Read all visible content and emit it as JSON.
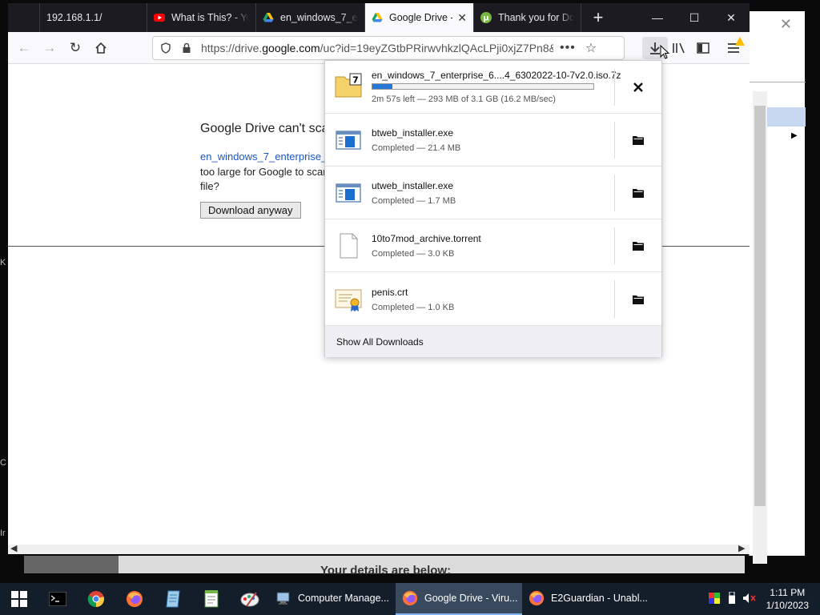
{
  "tabs": [
    {
      "label": "192.168.1.1/",
      "icon": "none"
    },
    {
      "label": "What is This? - Yo",
      "icon": "youtube-icon"
    },
    {
      "label": "en_windows_7_en",
      "icon": "google-drive-icon"
    },
    {
      "label": "Google Drive -",
      "icon": "google-drive-icon"
    },
    {
      "label": "Thank you for Do",
      "icon": "utorrent-icon"
    }
  ],
  "url": {
    "prefix": "https://drive.",
    "domain": "google.com",
    "suffix": "/uc?id=19eyZGtbPRirwvhkzlQAcLPji0xjZ7Pn8&"
  },
  "page": {
    "title": "Google Drive can't sca",
    "file_link": "en_windows_7_enterprise_",
    "text_line1": "too large for Google to scar",
    "text_line2": "file?",
    "download_button": "Download anyway"
  },
  "downloads": {
    "items": [
      {
        "name": "en_windows_7_enterprise_6....4_6302022-10-7v2.0.iso.7z",
        "status": "2m 57s left — 293 MB of 3.1 GB (16.2 MB/sec)",
        "progress": 0.092,
        "icon": "7z-archive-icon",
        "action_icon": "cancel-icon"
      },
      {
        "name": "btweb_installer.exe",
        "status": "Completed — 21.4 MB",
        "icon": "installer-icon",
        "action_icon": "folder-icon"
      },
      {
        "name": "utweb_installer.exe",
        "status": "Completed — 1.7 MB",
        "icon": "installer-icon",
        "action_icon": "folder-icon"
      },
      {
        "name": "10to7mod_archive.torrent",
        "status": "Completed — 3.0 KB",
        "icon": "file-icon",
        "action_icon": "folder-icon"
      },
      {
        "name": "penis.crt",
        "status": "Completed — 1.0 KB",
        "icon": "certificate-icon",
        "action_icon": "folder-icon"
      }
    ],
    "show_all": "Show All Downloads"
  },
  "behind": {
    "text": "Your details are below:"
  },
  "left_edge": [
    "K",
    "C",
    "Ir"
  ],
  "taskbar": {
    "apps": [
      {
        "label": "Computer Manage...",
        "icon": "computer-management-icon"
      },
      {
        "label": "Google Drive - Viru...",
        "icon": "firefox-icon",
        "active": true
      },
      {
        "label": "E2Guardian - Unabl...",
        "icon": "firefox-icon"
      }
    ],
    "time": "1:11 PM",
    "date": "1/10/2023"
  },
  "colors": {
    "accent": "#2a78d6",
    "tabbar": "#1c1b22",
    "taskbar": "#141d2a",
    "link": "#1a57c5"
  }
}
